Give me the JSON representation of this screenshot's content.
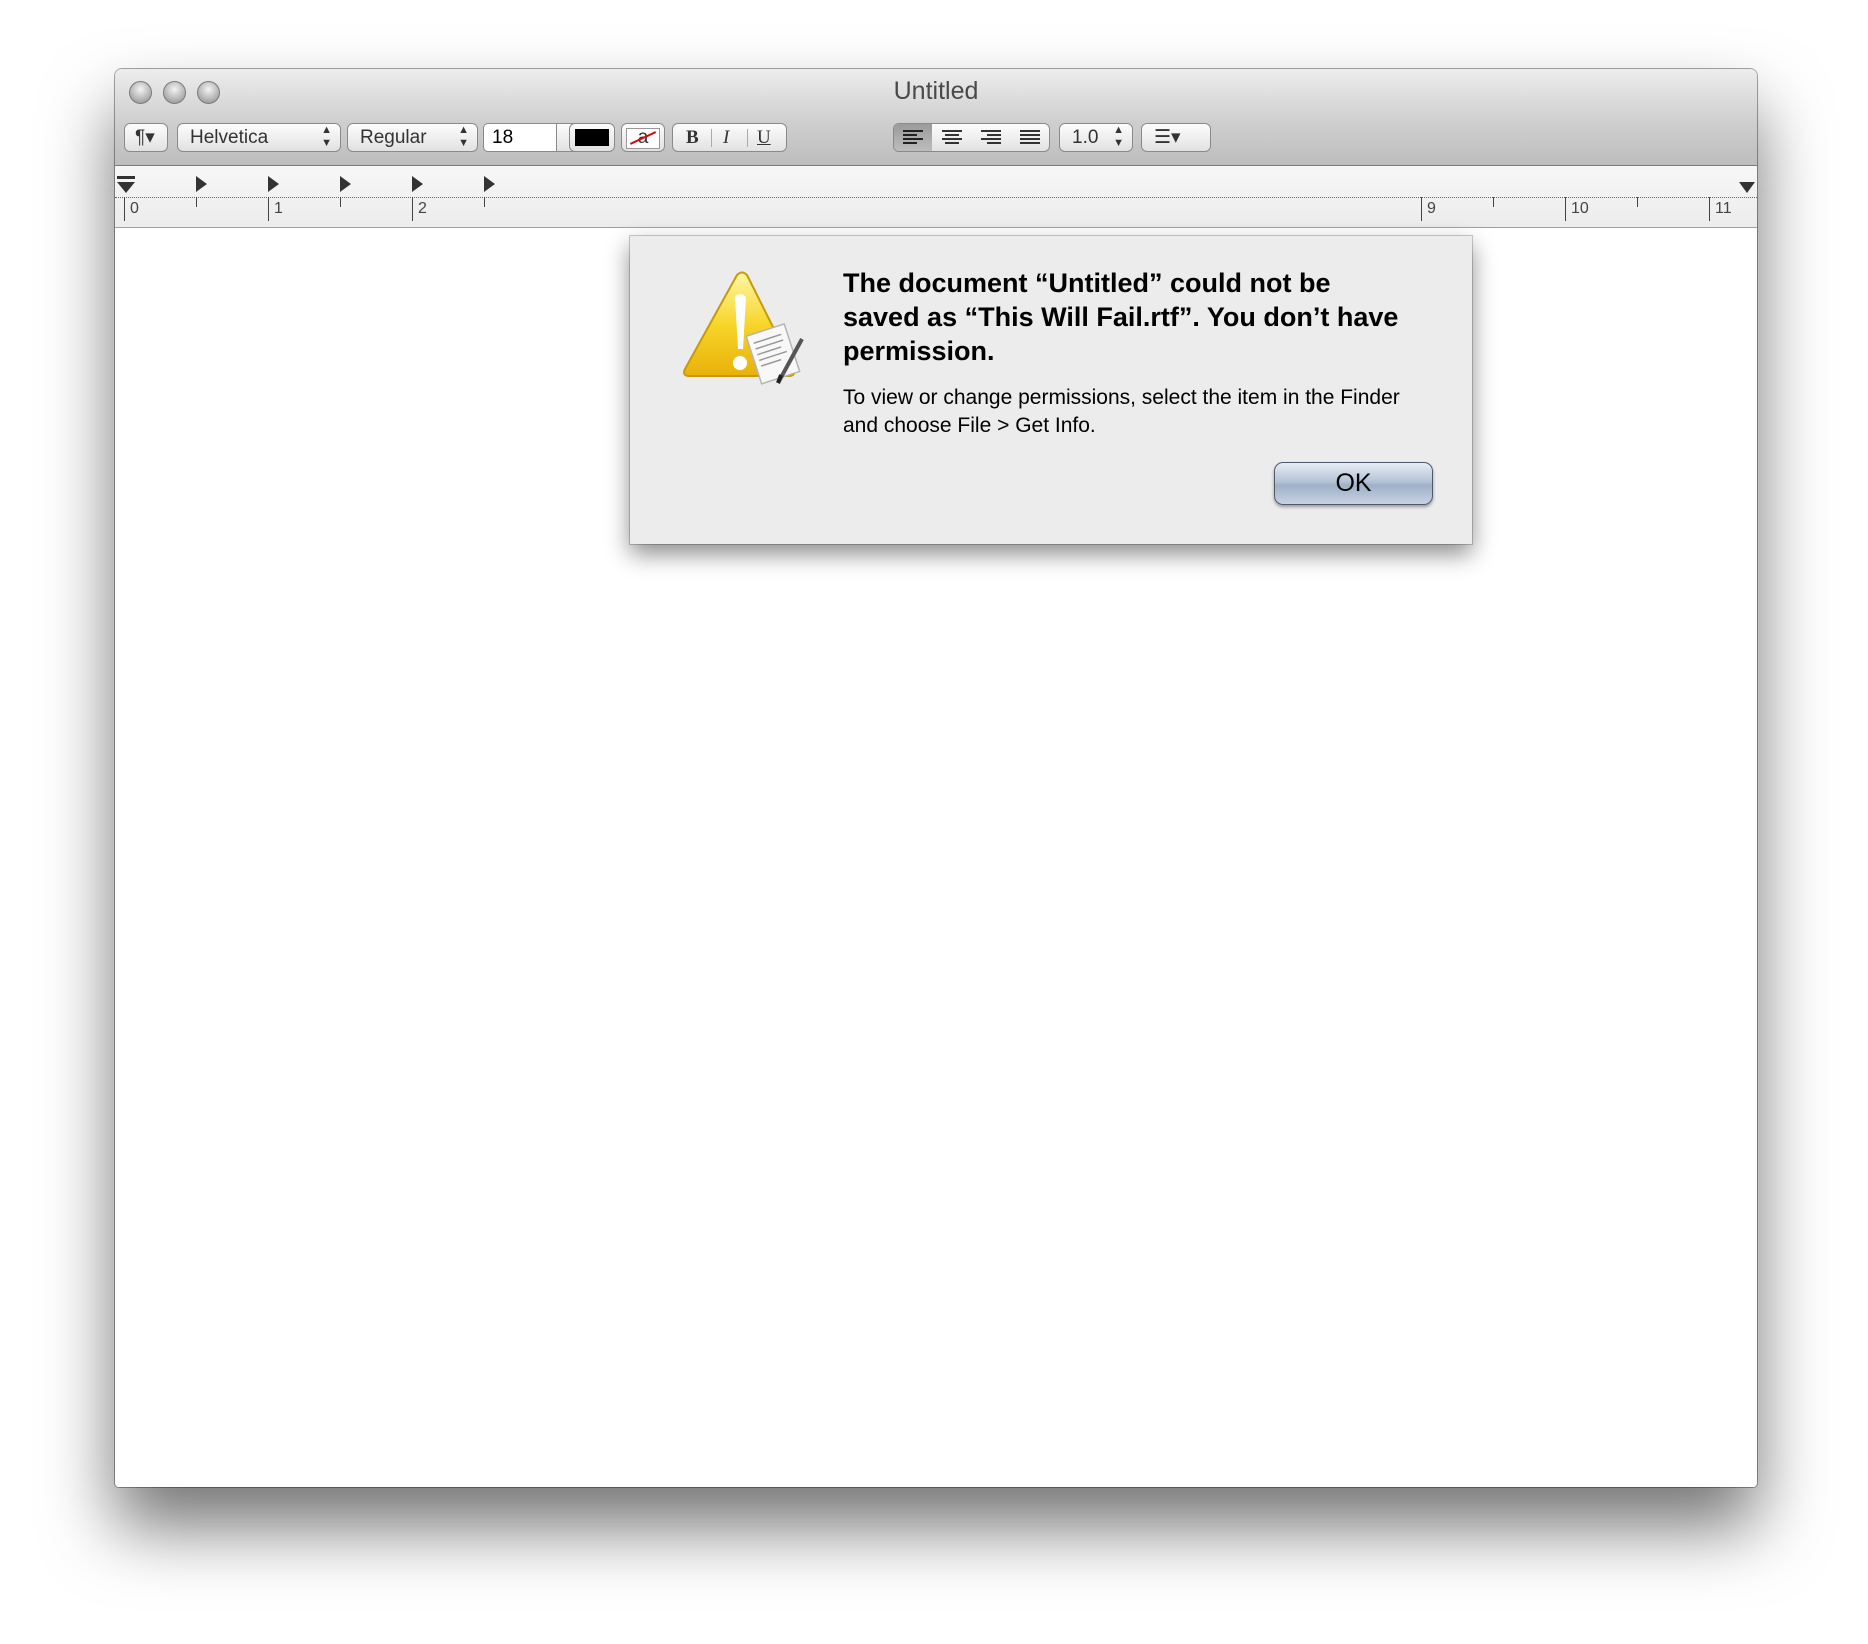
{
  "window": {
    "title": "Untitled"
  },
  "toolbar": {
    "paragraph_button": "¶▾",
    "font_family": "Helvetica",
    "font_style": "Regular",
    "font_size": "18",
    "highlight_label": "a",
    "bold_label": "B",
    "italic_label": "I",
    "underline_label": "U",
    "line_spacing": "1.0",
    "list_button": "☰▾"
  },
  "ruler": {
    "labels": [
      "0",
      "1",
      "2",
      "9",
      "10",
      "11"
    ]
  },
  "dialog": {
    "title": "The document “Untitled” could not be saved as “This Will Fail.rtf”. You don’t have permission.",
    "message": "To view or change permissions, select the item in the Finder and choose File > Get Info.",
    "ok_label": "OK"
  },
  "colors": {
    "text_color_swatch": "#000000",
    "ok_button_tint": "#a9b8cc"
  },
  "icons": {
    "dialog_icon": "caution-document-icon"
  }
}
